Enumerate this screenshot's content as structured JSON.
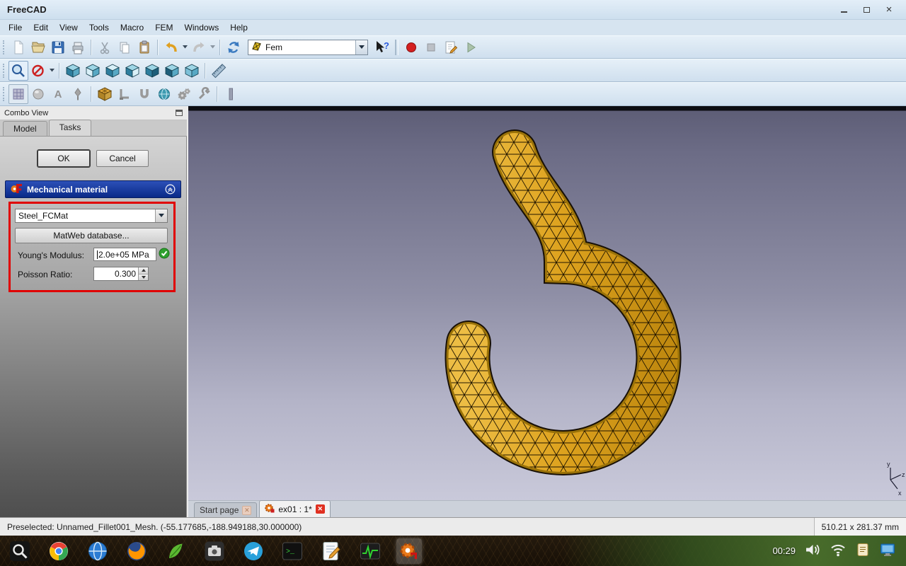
{
  "window": {
    "title": "FreeCAD"
  },
  "menu_bar": {
    "items": [
      "File",
      "Edit",
      "View",
      "Tools",
      "Macro",
      "FEM",
      "Windows",
      "Help"
    ]
  },
  "toolbars": {
    "workbench_selector": {
      "value": "Fem"
    }
  },
  "combo_view": {
    "title": "Combo View",
    "tabs": {
      "model": "Model",
      "tasks": "Tasks"
    },
    "task_panel": {
      "ok_label": "OK",
      "cancel_label": "Cancel",
      "section_title": "Mechanical material",
      "material": {
        "selected": "Steel_FCMat",
        "matweb_label": "MatWeb database...",
        "youngs_modulus_label": "Young's Modulus:",
        "youngs_modulus_value": "2.0e+05 MPa",
        "poisson_label": "Poisson Ratio:",
        "poisson_value": "0.300"
      }
    }
  },
  "mdi_tabs": {
    "start_page": "Start page",
    "document": "ex01 : 1*"
  },
  "viewport": {
    "axis_labels": {
      "x": "x",
      "y": "y",
      "z": "z"
    },
    "mesh_color": "#dda21e",
    "background_top": "#5e5e77",
    "background_bottom": "#c9c9da"
  },
  "status_bar": {
    "message": "Preselected: Unnamed_Fillet001_Mesh. (-55.177685,-188.949188,30.000000)",
    "dimensions": "510.21 x 281.37 mm"
  },
  "taskbar": {
    "clock": "00:29"
  }
}
